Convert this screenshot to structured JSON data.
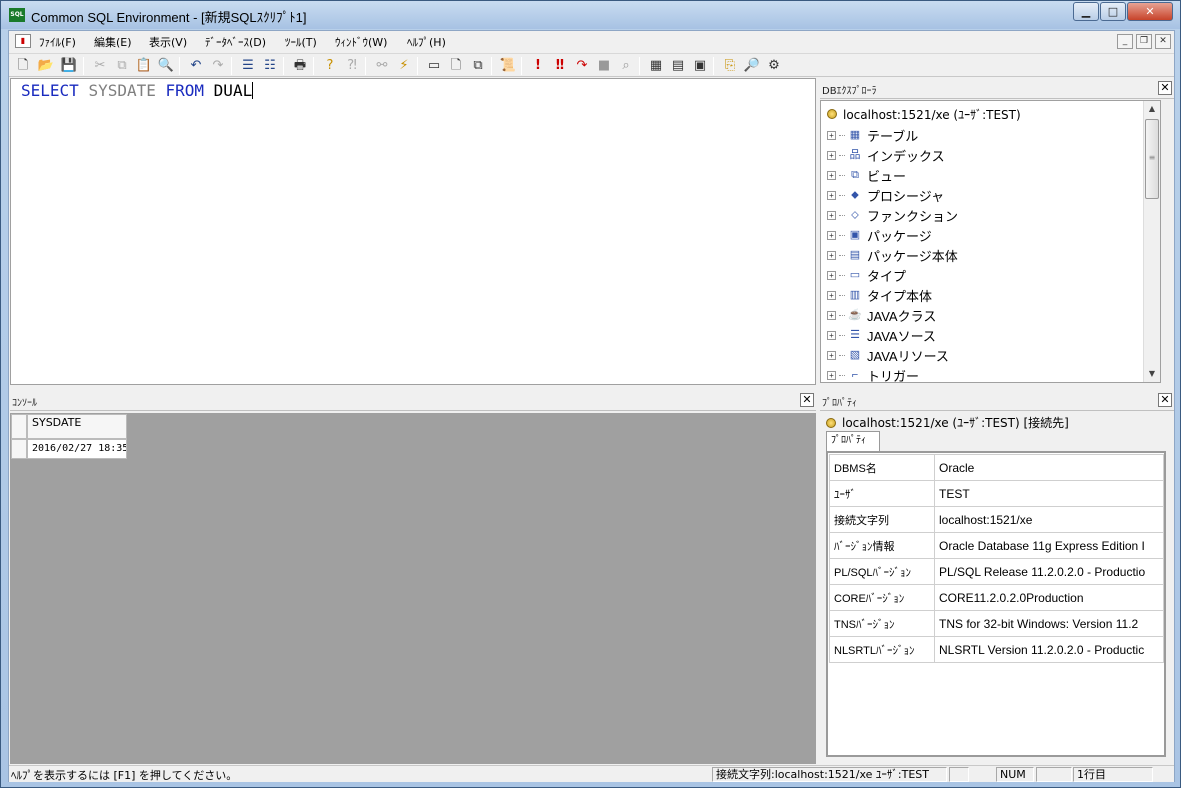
{
  "window": {
    "title": "Common SQL Environment - [新規SQLｽｸﾘﾌﾟﾄ1]",
    "app_icon_text": "SQL",
    "minimize": "▁",
    "maximize": "□",
    "close": "✕"
  },
  "menubar": {
    "items": [
      "ﾌｧｲﾙ(F)",
      "編集(E)",
      "表示(V)",
      "ﾃﾞｰﾀﾍﾞｰｽ(D)",
      "ﾂｰﾙ(T)",
      "ｳｨﾝﾄﾞｳ(W)",
      "ﾍﾙﾌﾟ(H)"
    ],
    "mdi_min": "_",
    "mdi_restore": "❐",
    "mdi_close": "✕"
  },
  "editor": {
    "tokens": [
      {
        "text": "SELECT ",
        "kind": "kw"
      },
      {
        "text": "SYSDATE ",
        "kind": "fn"
      },
      {
        "text": "FROM ",
        "kind": "kw"
      },
      {
        "text": "DUAL",
        "kind": "id"
      }
    ]
  },
  "db_explorer": {
    "title": "DBｴｸｽﾌﾟﾛｰﾗ",
    "root": "localhost:1521/xe (ﾕｰｻﾞ:TEST)",
    "items": [
      {
        "label": "テーブル",
        "icon": "▦"
      },
      {
        "label": "インデックス",
        "icon": "品"
      },
      {
        "label": "ビュー",
        "icon": "⧉"
      },
      {
        "label": "プロシージャ",
        "icon": "⬥"
      },
      {
        "label": "ファンクション",
        "icon": "⬦"
      },
      {
        "label": "パッケージ",
        "icon": "▣"
      },
      {
        "label": "パッケージ本体",
        "icon": "▤"
      },
      {
        "label": "タイプ",
        "icon": "▭"
      },
      {
        "label": "タイプ本体",
        "icon": "▥"
      },
      {
        "label": "JAVAクラス",
        "icon": "☕"
      },
      {
        "label": "JAVAソース",
        "icon": "☰"
      },
      {
        "label": "JAVAリソース",
        "icon": "▧"
      },
      {
        "label": "トリガー",
        "icon": "⌐"
      }
    ],
    "expander": "+",
    "scroll_up": "▲",
    "scroll_down": "▼",
    "scroll_grip": "≡"
  },
  "console": {
    "title": "ｺﾝｿｰﾙ",
    "column": "SYSDATE",
    "rows": [
      "2016/02/27 18:35:"
    ]
  },
  "properties": {
    "title": "ﾌﾟﾛﾊﾟﾃｨ",
    "connection": "localhost:1521/xe (ﾕｰｻﾞ:TEST) [接続先]",
    "tab": "ﾌﾟﾛﾊﾟﾃｨ",
    "rows": [
      {
        "key": "DBMS名",
        "value": "Oracle"
      },
      {
        "key": "ﾕｰｻﾞ",
        "value": "TEST"
      },
      {
        "key": "接続文字列",
        "value": "localhost:1521/xe"
      },
      {
        "key": "ﾊﾞｰｼﾞｮﾝ情報",
        "value": "Oracle Database 11g Express Edition I"
      },
      {
        "key": "PL/SQLﾊﾞｰｼﾞｮﾝ",
        "value": "PL/SQL Release 11.2.0.2.0 - Productio"
      },
      {
        "key": "COREﾊﾞｰｼﾞｮﾝ",
        "value": "CORE11.2.0.2.0Production"
      },
      {
        "key": "TNSﾊﾞｰｼﾞｮﾝ",
        "value": "TNS for 32-bit Windows: Version 11.2"
      },
      {
        "key": "NLSRTLﾊﾞｰｼﾞｮﾝ",
        "value": "NLSRTL Version 11.2.0.2.0 - Productic"
      }
    ]
  },
  "statusbar": {
    "help": "ﾍﾙﾌﾟを表示するには [F1] を押してください。",
    "connection": "接続文字列:localhost:1521/xe ﾕｰｻﾞ:TEST",
    "num": "NUM",
    "line": "1行目"
  }
}
